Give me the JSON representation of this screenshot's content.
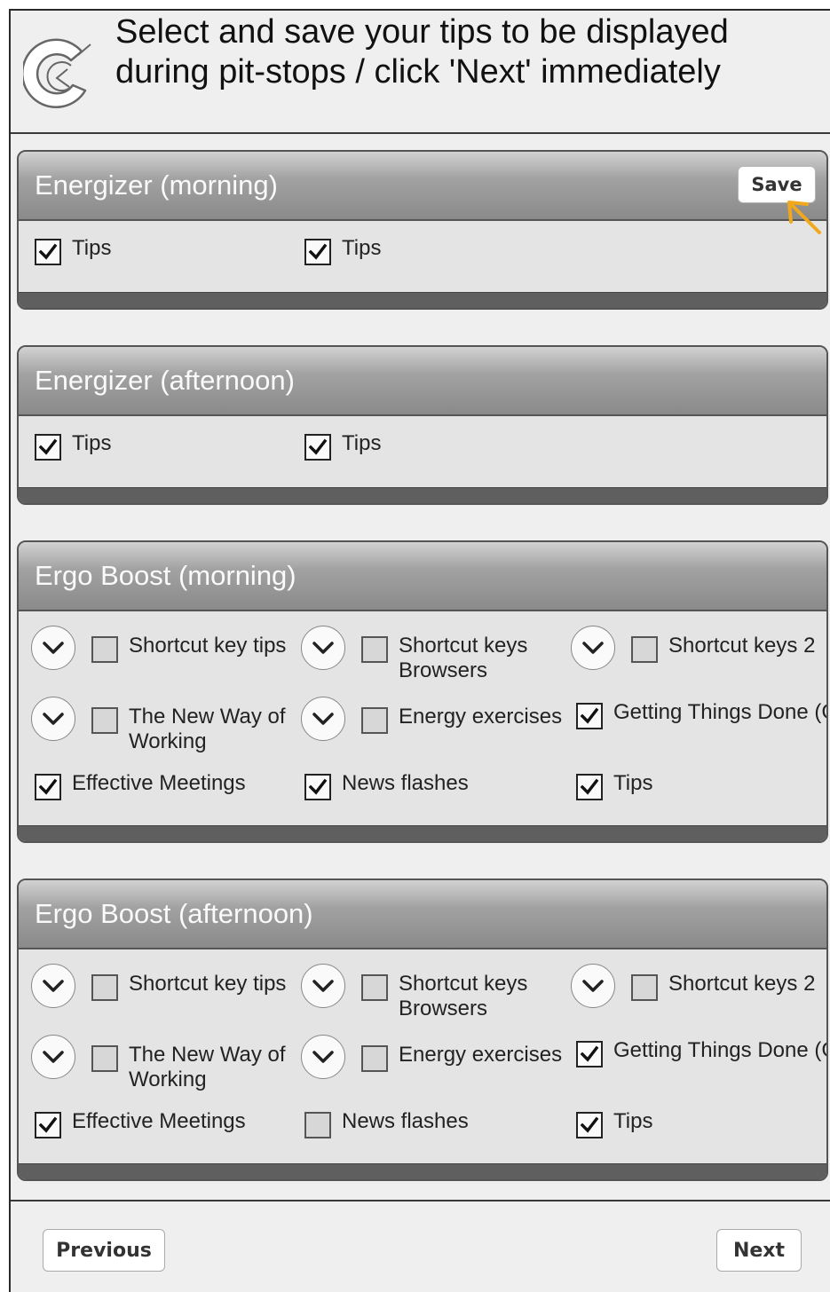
{
  "header": {
    "title": "Select and save your tips to be displayed during pit-stops / click 'Next' immediately"
  },
  "save_label": "Save",
  "panels": [
    {
      "title": "Energizer (morning)",
      "items": [
        {
          "label": "Tips",
          "checked": true
        },
        {
          "label": "Tips",
          "checked": true
        }
      ]
    },
    {
      "title": "Energizer (afternoon)",
      "items": [
        {
          "label": "Tips",
          "checked": true
        },
        {
          "label": "Tips",
          "checked": true
        }
      ]
    },
    {
      "title": "Ergo Boost (morning)",
      "items": [
        {
          "label": "Shortcut key tips",
          "checked": false,
          "expandable": true
        },
        {
          "label": "Shortcut keys Browsers",
          "checked": false,
          "expandable": true
        },
        {
          "label": "Shortcut keys 2",
          "checked": false,
          "expandable": true
        },
        {
          "label": "The New Way of Working",
          "checked": false,
          "expandable": true
        },
        {
          "label": "Energy exercises",
          "checked": false,
          "expandable": true
        },
        {
          "label": "Getting Things Done (G",
          "checked": true
        },
        {
          "label": "Effective Meetings",
          "checked": true
        },
        {
          "label": "News flashes",
          "checked": true
        },
        {
          "label": "Tips",
          "checked": true
        }
      ]
    },
    {
      "title": "Ergo Boost (afternoon)",
      "items": [
        {
          "label": "Shortcut key tips",
          "checked": false,
          "expandable": true
        },
        {
          "label": "Shortcut keys Browsers",
          "checked": false,
          "expandable": true
        },
        {
          "label": "Shortcut keys 2",
          "checked": false,
          "expandable": true
        },
        {
          "label": "The New Way of Working",
          "checked": false,
          "expandable": true
        },
        {
          "label": "Energy exercises",
          "checked": false,
          "expandable": true
        },
        {
          "label": "Getting Things Done (G",
          "checked": true
        },
        {
          "label": "Effective Meetings",
          "checked": true
        },
        {
          "label": "News flashes",
          "checked": false
        },
        {
          "label": "Tips",
          "checked": true
        }
      ]
    }
  ],
  "nav": {
    "previous_label": "Previous",
    "next_label": "Next"
  },
  "colors": {
    "accent_arrow": "#f2a81d",
    "panel_header": "#9a9a9a",
    "panel_body": "#e4e4e4"
  },
  "icons": {
    "logo": "c-logo-icon",
    "expand": "chevron-down-icon",
    "check": "checkmark-icon",
    "pointer": "arrow-pointer-icon"
  }
}
